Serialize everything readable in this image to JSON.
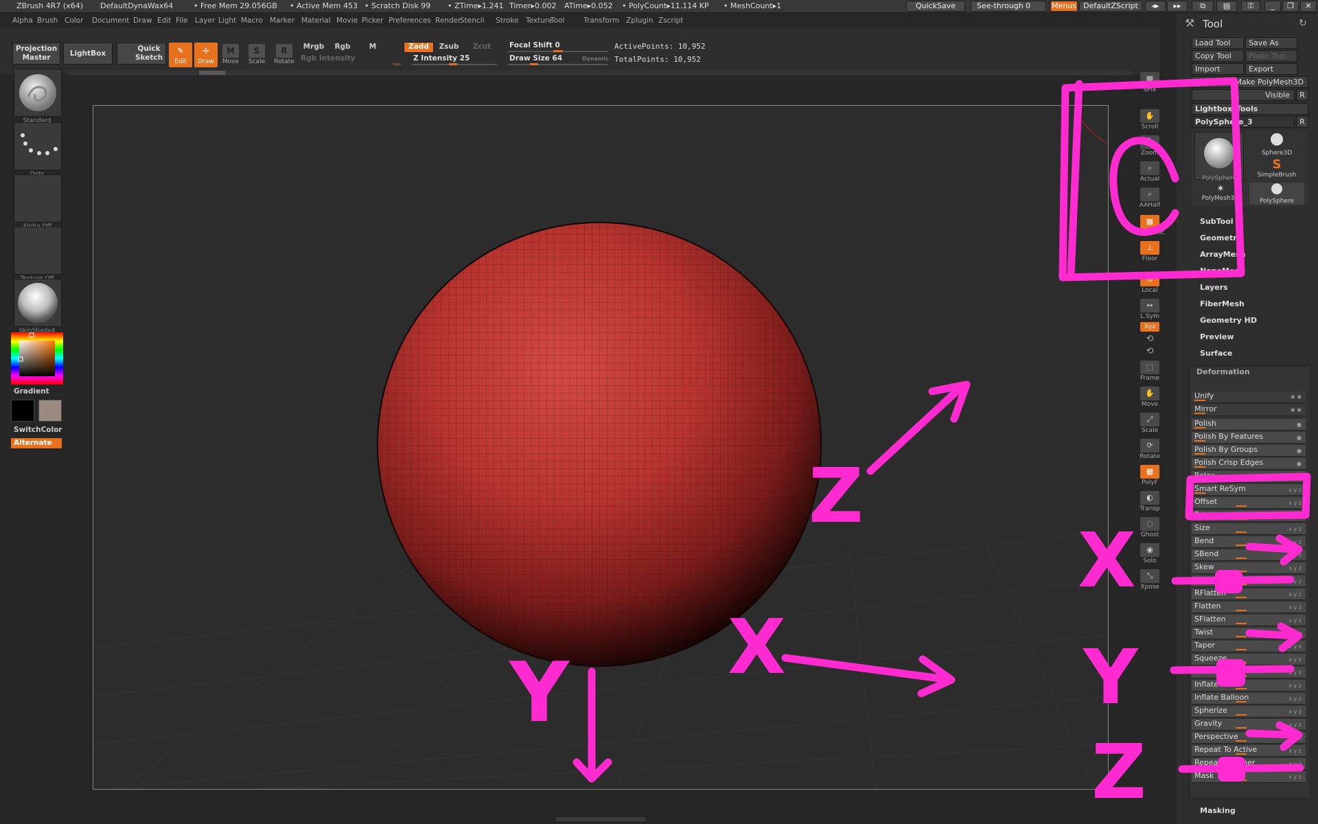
{
  "title_bar": {
    "app": "ZBrush 4R7 (x64)",
    "material": "DefaultDynaWax64",
    "free_mem": "• Free Mem 29.056GB",
    "active_mem": "• Active Mem 453",
    "scratch_disk": "• Scratch Disk 99",
    "ztime": "• ZTime▸1.241",
    "timer": "Timer▸0.002",
    "atime": "ATime▸0.052",
    "polycount": "• PolyCount▸11.114 KP",
    "meshcount": "• MeshCount▸1",
    "quicksave": "QuickSave",
    "seethrough": "See-through  0",
    "menus": "Menus",
    "zscript": "DefaultZScript"
  },
  "menu_bar": [
    "Alpha",
    "Brush",
    "Color",
    "Document",
    "Draw",
    "Edit",
    "File",
    "Layer",
    "Light",
    "Macro",
    "Marker",
    "Material",
    "Movie",
    "Picker",
    "Preferences",
    "Render",
    "Stencil",
    "Stroke",
    "Texture",
    "Tool",
    "Transform",
    "Zplugin",
    "Zscript"
  ],
  "shelf": {
    "projection_master": "Projection Master",
    "lightbox": "LightBox",
    "quick_sketch": "Quick Sketch",
    "edit": "Edit",
    "draw": "Draw",
    "move": "Move",
    "scale": "Scale",
    "rotate": "Rotate",
    "mrgb": "Mrgb",
    "rgb": "Rgb",
    "m": "M",
    "rgb_intensity": "Rgb Intensity",
    "zadd": "Zadd",
    "zsub": "Zsub",
    "zcut": "Zcut",
    "z_intensity": "Z Intensity 25",
    "focal_shift": "Focal Shift 0",
    "draw_size": "Draw Size 64",
    "dynamic": "Dynamic",
    "active_points": "ActivePoints: 10,952",
    "total_points": "TotalPoints: 10,952"
  },
  "left_panel": {
    "brush": "Standard",
    "stroke": "Dots",
    "alpha": "Alpha Off",
    "texture": "Texture Off",
    "material": "SkinShade4",
    "gradient": "Gradient",
    "switch_color": "SwitchColor",
    "alternate": "Alternate"
  },
  "right_shelf": [
    "SPix",
    "Scroll",
    "Zoom",
    "Actual",
    "AAHalf",
    "Dynamic",
    "Floor",
    "Local",
    "L.Sym",
    "Xyz",
    "",
    "",
    "Frame",
    "Move",
    "Scale",
    "Rotate",
    "PolyF",
    "Transp",
    "Ghost",
    "Solo",
    "Xpose"
  ],
  "tool_panel": {
    "title": "Tool",
    "load_tool": "Load Tool",
    "save_as": "Save As",
    "copy_tool": "Copy Tool",
    "paste_tool": "Paste Tool",
    "import": "Import",
    "export": "Export",
    "make_polymesh": "Make PolyMesh3D",
    "visible": "Visible",
    "r": "R",
    "lightbox_tools": "Lightbox▸Tools",
    "current_tool": "PolySphere_3",
    "thumbs": [
      "PolySphere",
      "Sphere3D",
      "SimpleBrush",
      "PolyMesh3D",
      "PolySphere"
    ],
    "sections": [
      "SubTool",
      "Geometry",
      "ArrayMesh",
      "NanoMesh",
      "Layers",
      "FiberMesh",
      "Geometry HD",
      "Preview",
      "Surface"
    ],
    "deformation_title": "Deformation",
    "deformation": [
      "Unify",
      "Mirror",
      "Polish",
      "Polish By Features",
      "Polish By Groups",
      "Polish Crisp Edges",
      "Relax",
      "Smart ReSym",
      "Offset",
      "Rotate",
      "Size",
      "Bend",
      "SBend",
      "Skew",
      "SSkew",
      "RFlatten",
      "Flatten",
      "SFlatten",
      "Twist",
      "Taper",
      "Squeeze",
      "Noise",
      "Inflate",
      "Inflate Balloon",
      "Spherize",
      "Gravity",
      "Perspective",
      "Repeat To Active",
      "Repeat To Other",
      "Mask"
    ],
    "masking": "Masking"
  },
  "annotations": {
    "x1": "X",
    "x2": "X",
    "y1": "Y",
    "y2": "Y",
    "z1": "Z",
    "z2": "Z",
    "c": "C"
  },
  "colors": {
    "accent": "#e8711d",
    "sphere": "#c23a33",
    "annot": "#ff2ad0"
  }
}
